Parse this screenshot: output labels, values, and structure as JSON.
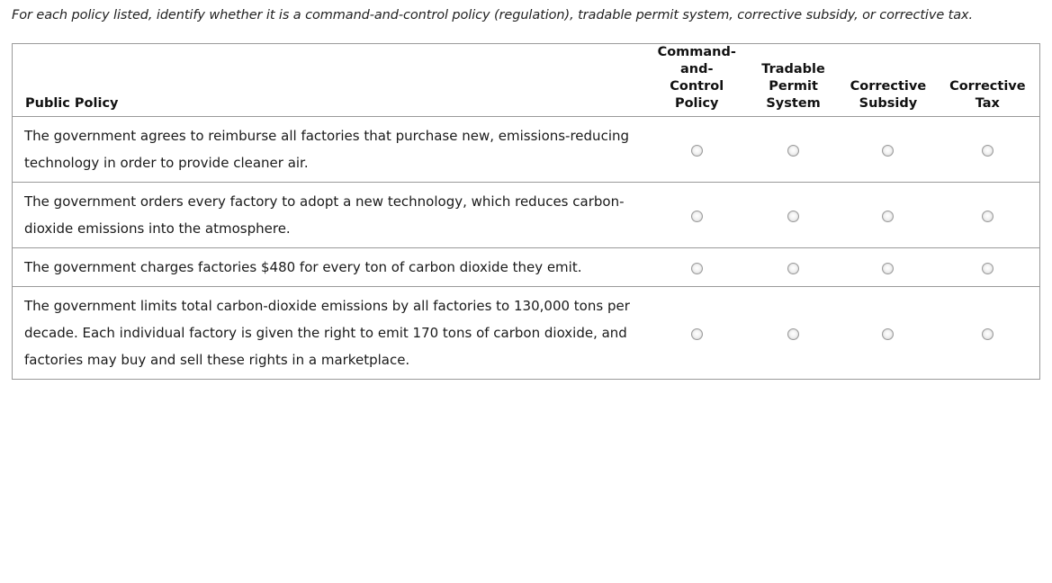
{
  "instructions": "For each policy listed, identify whether it is a command-and-control policy (regulation), tradable permit system, corrective subsidy, or corrective tax.",
  "table": {
    "headers": {
      "policy": "Public Policy",
      "options": [
        {
          "line1": "Command-",
          "line2": "and-",
          "line3": "Control",
          "line4": "Policy"
        },
        {
          "line1": "",
          "line2": "Tradable",
          "line3": "Permit",
          "line4": "System"
        },
        {
          "line1": "",
          "line2": "",
          "line3": "Corrective",
          "line4": "Subsidy"
        },
        {
          "line1": "",
          "line2": "",
          "line3": "Corrective",
          "line4": "Tax"
        }
      ]
    },
    "rows": [
      {
        "policy": "The government agrees to reimburse all factories that purchase new, emissions-reducing technology in order to provide cleaner air.",
        "selected": null
      },
      {
        "policy": "The government orders every factory to adopt a new technology, which reduces carbon-dioxide emissions into the atmosphere.",
        "selected": null
      },
      {
        "policy": "The government charges factories $480 for every ton of carbon dioxide they emit.",
        "selected": null
      },
      {
        "policy": "The government limits total carbon-dioxide emissions by all factories to 130,000 tons per decade. Each individual factory is given the right to emit 170 tons of carbon dioxide, and factories may buy and sell these rights in a marketplace.",
        "selected": null
      }
    ]
  }
}
